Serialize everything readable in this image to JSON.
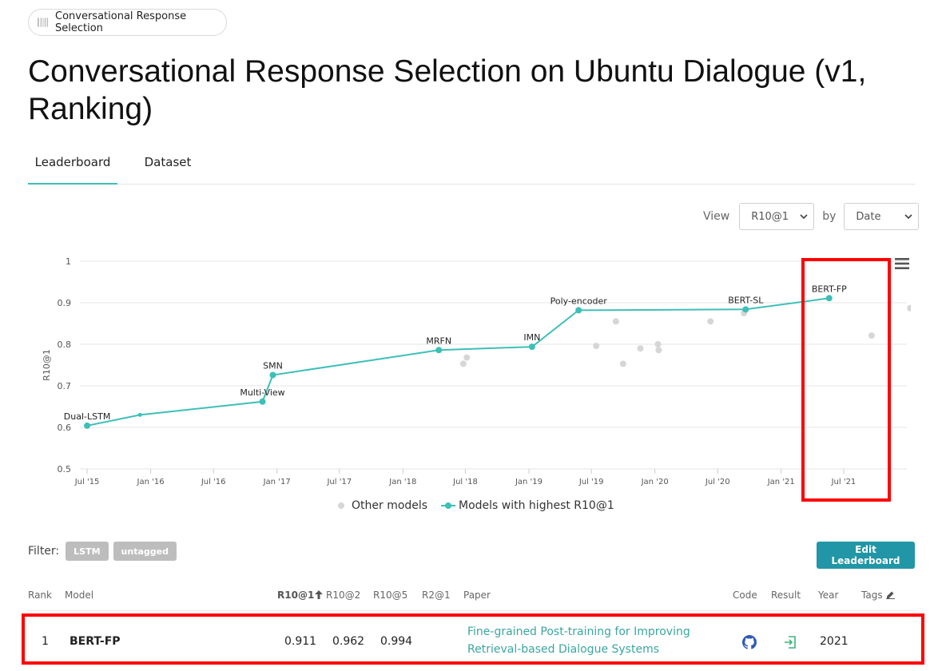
{
  "breadcrumb": {
    "label": "Conversational Response Selection",
    "icon": "task-icon"
  },
  "page_title": "Conversational Response Selection on Ubuntu Dialogue (v1, Ranking)",
  "tabs": [
    {
      "label": "Leaderboard",
      "active": true
    },
    {
      "label": "Dataset",
      "active": false
    }
  ],
  "view_controls": {
    "view_label": "View",
    "metric_selected": "R10@1",
    "by_label": "by",
    "by_selected": "Date"
  },
  "chart_data": {
    "type": "line",
    "ylabel": "R10@1",
    "ylim": [
      0.5,
      1
    ],
    "y_ticks": [
      "0.5",
      "0.6",
      "0.7",
      "0.8",
      "0.9",
      "1"
    ],
    "x_ticks": [
      "Jul '15",
      "Jan '16",
      "Jul '16",
      "Jan '17",
      "Jul '17",
      "Jan '18",
      "Jul '18",
      "Jan '19",
      "Jul '19",
      "Jan '20",
      "Jul '20",
      "Jan '21",
      "Jul '21"
    ],
    "x_range": [
      "2015-06-10",
      "2021-12-31"
    ],
    "grid": true,
    "legend": [
      "Other models",
      "Models with highest R10@1"
    ],
    "legend_position": "bottom",
    "best_series": {
      "name": "Models with highest R10@1",
      "color": "#3dbfb8",
      "points": [
        {
          "date": "2015-07-01",
          "value": 0.604,
          "label": "Dual-LSTM"
        },
        {
          "date": "2015-12-01",
          "value": 0.63,
          "label": ""
        },
        {
          "date": "2016-11-20",
          "value": 0.662,
          "label": "Multi-View"
        },
        {
          "date": "2016-12-20",
          "value": 0.726,
          "label": "SMN"
        },
        {
          "date": "2018-04-15",
          "value": 0.786,
          "label": "MRFN"
        },
        {
          "date": "2019-01-10",
          "value": 0.794,
          "label": "IMN"
        },
        {
          "date": "2019-05-25",
          "value": 0.882,
          "label": "Poly-encoder"
        },
        {
          "date": "2020-09-20",
          "value": 0.884,
          "label": "BERT-SL"
        },
        {
          "date": "2021-05-20",
          "value": 0.911,
          "label": "BERT-FP"
        }
      ]
    },
    "other_series": {
      "name": "Other models",
      "color": "#d6d6d6",
      "points": [
        {
          "date": "2018-06-25",
          "value": 0.753
        },
        {
          "date": "2018-07-05",
          "value": 0.768
        },
        {
          "date": "2019-07-15",
          "value": 0.796
        },
        {
          "date": "2019-09-10",
          "value": 0.855
        },
        {
          "date": "2019-10-01",
          "value": 0.753
        },
        {
          "date": "2019-11-20",
          "value": 0.79
        },
        {
          "date": "2020-01-10",
          "value": 0.8
        },
        {
          "date": "2020-01-12",
          "value": 0.786
        },
        {
          "date": "2020-06-10",
          "value": 0.855
        },
        {
          "date": "2020-09-15",
          "value": 0.875
        },
        {
          "date": "2021-09-20",
          "value": 0.821
        },
        {
          "date": "2022-01-10",
          "value": 0.887
        }
      ]
    }
  },
  "filter": {
    "label": "Filter:",
    "tags": [
      "LSTM",
      "untagged"
    ]
  },
  "edit_button": "Edit Leaderboard",
  "table": {
    "headers": {
      "rank": "Rank",
      "model": "Model",
      "r10_1": "R10@1",
      "r10_2": "R10@2",
      "r10_5": "R10@5",
      "r2_1": "R2@1",
      "paper": "Paper",
      "code": "Code",
      "result": "Result",
      "year": "Year",
      "tags": "Tags"
    },
    "rows": [
      {
        "rank": "1",
        "model": "BERT-FP",
        "r10_1": "0.911",
        "r10_2": "0.962",
        "r10_5": "0.994",
        "r2_1": "",
        "paper": "Fine-grained Post-training for Improving Retrieval-based Dialogue Systems",
        "year": "2021"
      }
    ]
  }
}
